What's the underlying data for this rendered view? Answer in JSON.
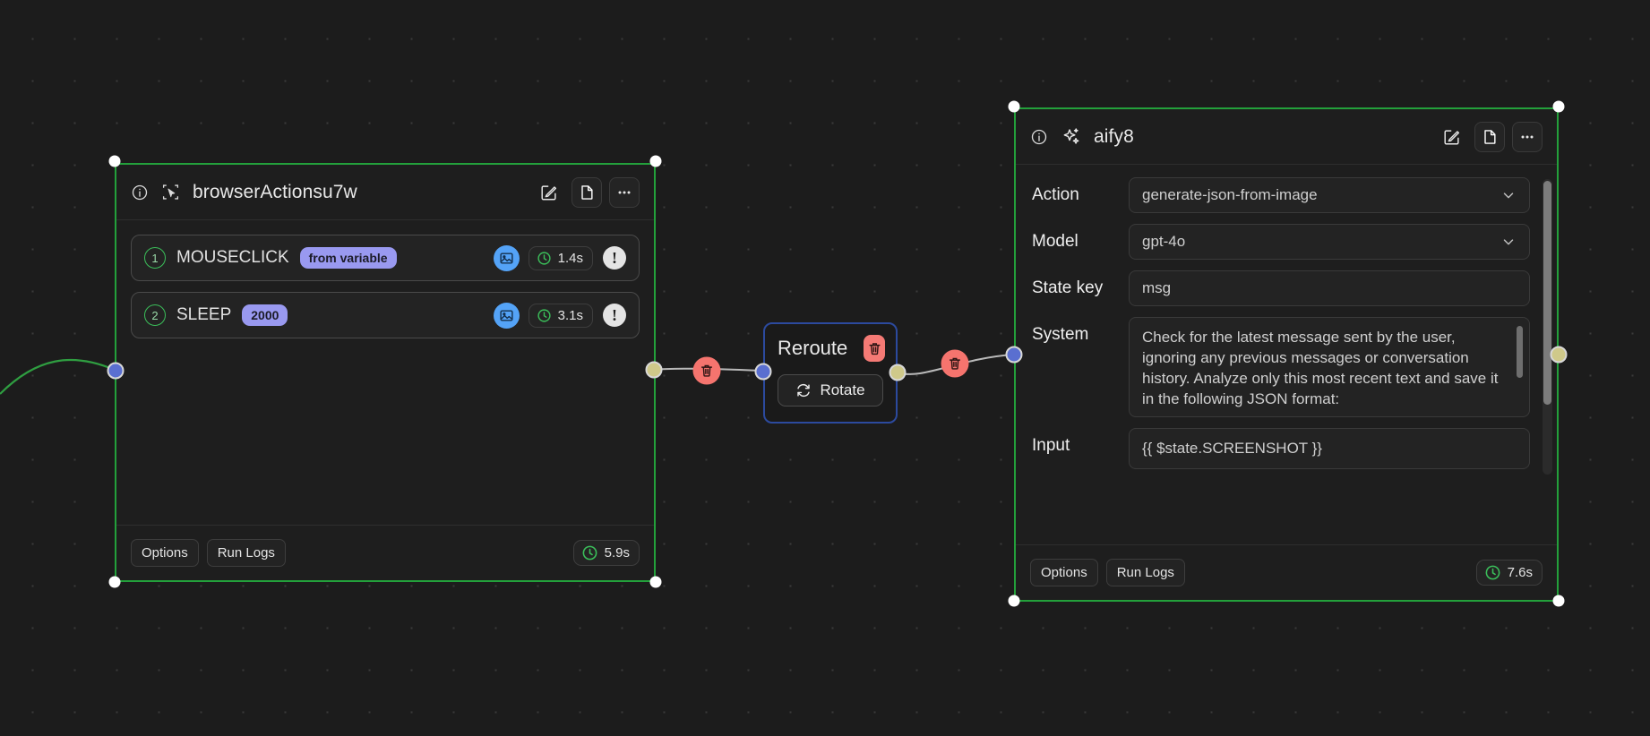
{
  "canvas": {
    "background_color": "#1c1c1c",
    "grid_dot_color": "#3a3a3a",
    "selection_color": "#23a03b"
  },
  "nodes": {
    "browser": {
      "title": "browserActionsu7w",
      "icon": "cursor-select-icon",
      "info_icon": "info-icon",
      "header_buttons": [
        {
          "name": "edit-icon",
          "glyph": "edit"
        },
        {
          "name": "duplicate-icon",
          "glyph": "file"
        },
        {
          "name": "more-options-icon",
          "glyph": "ellipsis"
        }
      ],
      "steps": [
        {
          "index": "1",
          "name": "MOUSECLICK",
          "param": "from variable",
          "image_badge": "image-icon",
          "duration": "1.4s",
          "warning": "!"
        },
        {
          "index": "2",
          "name": "SLEEP",
          "param": "2000",
          "image_badge": "image-icon",
          "duration": "3.1s",
          "warning": "!"
        }
      ],
      "footer": {
        "options_label": "Options",
        "run_logs_label": "Run Logs",
        "duration": "5.9s"
      }
    },
    "reroute": {
      "title": "Reroute",
      "delete_icon": "trash-icon",
      "rotate_label": "Rotate",
      "rotate_icon": "refresh-icon"
    },
    "aify": {
      "title": "aify8",
      "icon": "sparkles-icon",
      "info_icon": "info-icon",
      "header_buttons": [
        {
          "name": "edit-icon",
          "glyph": "edit"
        },
        {
          "name": "duplicate-icon",
          "glyph": "file"
        },
        {
          "name": "more-options-icon",
          "glyph": "ellipsis"
        }
      ],
      "fields": {
        "action": {
          "label": "Action",
          "value": "generate-json-from-image"
        },
        "model": {
          "label": "Model",
          "value": "gpt-4o"
        },
        "state_key": {
          "label": "State key",
          "value": "msg"
        },
        "system": {
          "label": "System",
          "value": "Check for the latest message sent by the user, ignoring any previous messages or conversation history. Analyze only this most recent text and save it in the following JSON format:"
        },
        "input": {
          "label": "Input",
          "value": "{{ $state.SCREENSHOT }}"
        }
      },
      "footer": {
        "options_label": "Options",
        "run_logs_label": "Run Logs",
        "duration": "7.6s"
      }
    }
  },
  "edges": [
    {
      "name": "edge-incoming-browser",
      "color": "#2f9e41",
      "delete_icon": null
    },
    {
      "name": "edge-browser-to-reroute",
      "color": "#b8b8b8",
      "delete_icon": "trash-icon"
    },
    {
      "name": "edge-reroute-to-aify",
      "color": "#b8b8b8",
      "delete_icon": "trash-icon"
    }
  ]
}
